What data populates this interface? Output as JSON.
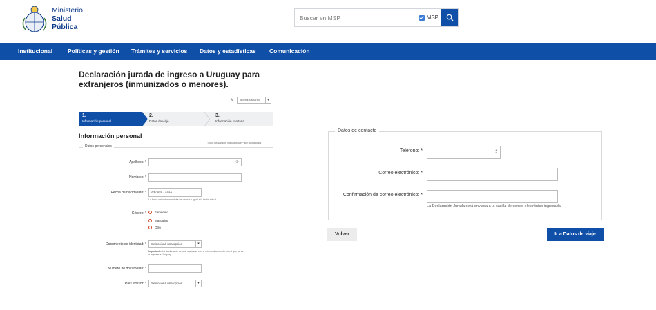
{
  "header": {
    "brand_line1": "Ministerio",
    "brand_line2": "Salud",
    "brand_line3": "Pública",
    "search_placeholder": "Buscar en MSP",
    "search_scope_label": "MSP"
  },
  "nav": {
    "items": [
      {
        "label": "Institucional"
      },
      {
        "label": "Políticas y gestión"
      },
      {
        "label": "Trámites y servicios"
      },
      {
        "label": "Datos y estadísticas"
      },
      {
        "label": "Comunicación"
      }
    ]
  },
  "page": {
    "title": "Declaración jurada de ingreso a Uruguay para extranjeros (inmunizados o menores).",
    "language_select": "Idioma: Español"
  },
  "steps": [
    {
      "number": "1.",
      "label": "Información personal",
      "active": true
    },
    {
      "number": "2.",
      "label": "Datos de viaje",
      "active": false
    },
    {
      "number": "3.",
      "label": "Información sanitaria",
      "active": false
    }
  ],
  "personal": {
    "section_title": "Información personal",
    "required_hint": "Todos los campos indicados con * son obligatorios",
    "legend": "Datos personales",
    "surname_label": "Apellidos: *",
    "names_label": "Nombres: *",
    "dob_label": "Fecha de nacimiento: *",
    "dob_placeholder": "dd / mm / aaaa",
    "dob_note": "La fecha seleccionada debe ser menor o igual a la fecha actual.",
    "gender_label": "Género: *",
    "gender_options": [
      "Femenino",
      "Masculino",
      "Otro"
    ],
    "id_doc_label": "Documento de identidad: *",
    "select_placeholder": "Seleccioná una opción",
    "id_note_bold": "Importante:",
    "id_note_line1": "La declaración deberá realizarse con el mismo documento con el que se va",
    "id_note_line2": "a ingresar a Uruguay.",
    "doc_number_label": "Número de documento: *",
    "country_label": "País emisor: *"
  },
  "contact": {
    "legend": "Datos de contacto",
    "phone_label": "Teléfono: *",
    "email_label": "Correo electrónico: *",
    "email_confirm_label": "Confirmación de correo electrónico: *",
    "email_note": "La Declaración Jurada será enviada a la casilla de correo electrónico ingresada."
  },
  "actions": {
    "back_label": "Volver",
    "next_label": "Ir a Datos de viaje"
  },
  "colors": {
    "primary": "#0f4fa8",
    "radio_border": "#d14b2c"
  }
}
